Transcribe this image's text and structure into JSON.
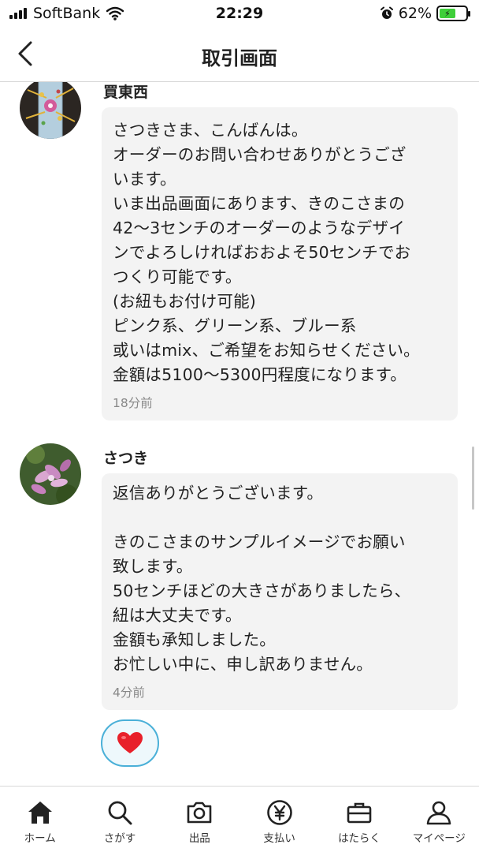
{
  "status_bar": {
    "carrier": "SoftBank",
    "time": "22:29",
    "battery": "62%",
    "battery_level": 0.62
  },
  "nav": {
    "title": "取引画面",
    "back_icon": "chevron-left-icon"
  },
  "messages": [
    {
      "sender": "買東西",
      "text": "さつきさま、こんばんは。\nオーダーのお問い合わせありがとうござ\nいます。\nいま出品画面にあります、きのこさまの\n42～3センチのオーダーのようなデザイ\nンでよろしければおおよそ50センチでお\nつくり可能です。\n(お紐もお付け可能)\nピンク系、グリーン系、ブルー系\n或いはmix、ご希望をお知らせください。\n金額は5100～5300円程度になります。",
      "time": "18分前"
    },
    {
      "sender": "さつき",
      "text": "返信ありがとうございます。\n\nきのこさまのサンプルイメージでお願い\n致します。\n50センチほどの大きさがありましたら、\n紐は大丈夫です。\n金額も承知しました。\nお忙しい中に、申し訳ありません。",
      "time": "4分前"
    }
  ],
  "reaction": {
    "icon": "heart-icon",
    "color": "#e8202a"
  },
  "tabs": [
    {
      "label": "ホーム",
      "icon": "home-icon"
    },
    {
      "label": "さがす",
      "icon": "search-icon"
    },
    {
      "label": "出品",
      "icon": "camera-icon"
    },
    {
      "label": "支払い",
      "icon": "yen-icon"
    },
    {
      "label": "はたらく",
      "icon": "briefcase-icon"
    },
    {
      "label": "マイページ",
      "icon": "person-icon"
    }
  ]
}
